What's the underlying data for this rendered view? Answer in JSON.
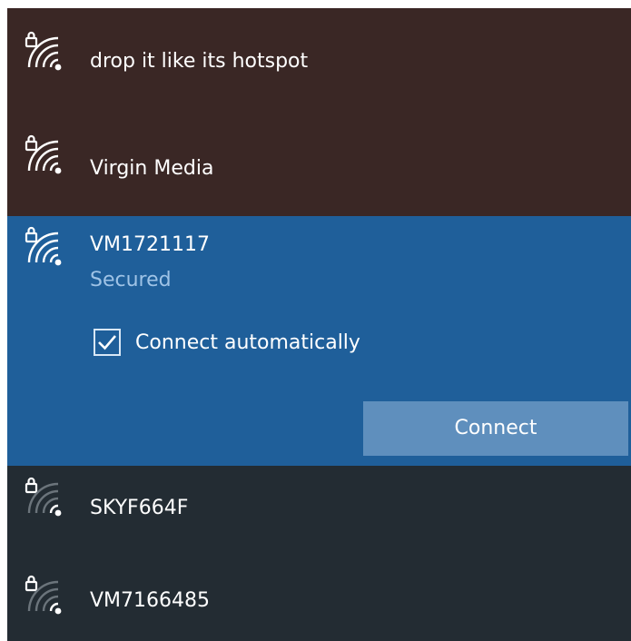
{
  "colors": {
    "unselected_top_bg": "#3a2725",
    "selected_bg": "#1f5f9a",
    "unselected_bottom_bg": "#232c33",
    "button_bg": "#5f8fbd",
    "secondary_text": "#9fc3e6",
    "text": "#ffffff"
  },
  "networks": [
    {
      "name": "drop it like its hotspot",
      "icon": "wifi-secured-icon",
      "selected": false
    },
    {
      "name": "Virgin Media",
      "icon": "wifi-secured-icon",
      "selected": false
    },
    {
      "name": "VM1721117",
      "status": "Secured",
      "icon": "wifi-secured-icon",
      "selected": true,
      "connect_automatically": {
        "label": "Connect automatically",
        "checked": true
      },
      "connect_button_label": "Connect"
    },
    {
      "name": "SKYF664F",
      "icon": "wifi-secured-weak-icon",
      "selected": false
    },
    {
      "name": "VM7166485",
      "icon": "wifi-secured-weak-icon",
      "selected": false
    }
  ]
}
